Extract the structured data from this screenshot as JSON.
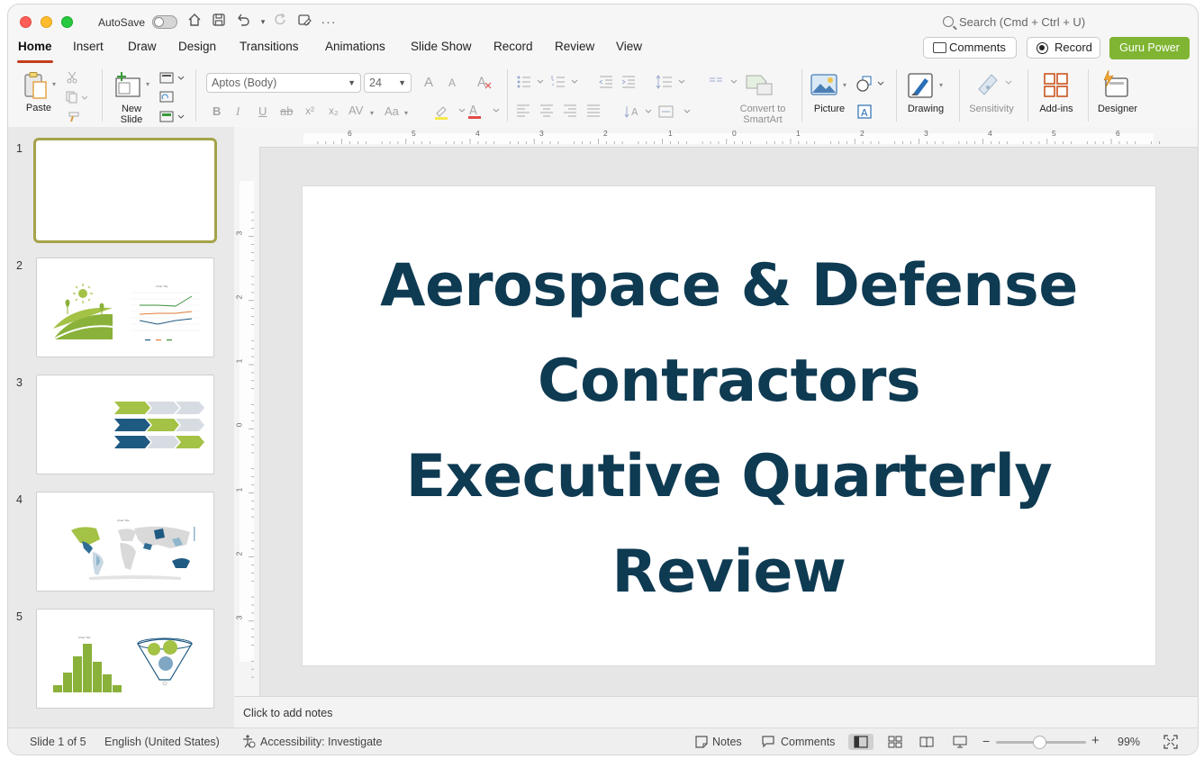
{
  "titlebar": {
    "autosave_label": "AutoSave",
    "search_placeholder": "Search (Cmd + Ctrl + U)"
  },
  "menu": {
    "tabs": [
      "Home",
      "Insert",
      "Draw",
      "Design",
      "Transitions",
      "Animations",
      "Slide Show",
      "Record",
      "Review",
      "View"
    ],
    "active_tab": "Home",
    "comments_label": "Comments",
    "record_label": "Record",
    "guru_label": "Guru Power"
  },
  "ribbon": {
    "paste": "Paste",
    "new_slide_line1": "New",
    "new_slide_line2": "Slide",
    "font_name": "Aptos (Body)",
    "font_size": "24",
    "convert_line1": "Convert to",
    "convert_line2": "SmartArt",
    "picture": "Picture",
    "drawing": "Drawing",
    "sensitivity": "Sensitivity",
    "addins": "Add-ins",
    "designer": "Designer",
    "bold": "B",
    "italic": "I",
    "underline": "U",
    "strike": "ab",
    "superscript": "x²",
    "subscript": "x₂",
    "spacing": "AV",
    "case": "Aa",
    "grow": "A",
    "shrink": "A"
  },
  "slides": {
    "numbers": [
      "1",
      "2",
      "3",
      "4",
      "5"
    ],
    "thumb2_chart_title": "Chart Title",
    "thumb4_chart_title": "Chart Title",
    "thumb5_chart_title": "Chart Title",
    "selected_index": 1
  },
  "ruler": {
    "h_labels": [
      "6",
      "5",
      "4",
      "3",
      "2",
      "1",
      "0",
      "1",
      "2",
      "3",
      "4",
      "5",
      "6"
    ],
    "v_labels": [
      "3",
      "2",
      "1",
      "0",
      "1",
      "2",
      "3"
    ]
  },
  "slide": {
    "title_lines": [
      "Aerospace & Defense",
      "Contractors",
      "Executive Quarterly",
      "Review"
    ]
  },
  "notes": {
    "placeholder": "Click to add notes"
  },
  "status": {
    "slide_position": "Slide 1 of 5",
    "language": "English (United States)",
    "accessibility": "Accessibility: Investigate",
    "notes": "Notes",
    "comments": "Comments",
    "zoom": "99%",
    "zoom_minus": "−",
    "zoom_plus": "+"
  },
  "colors": {
    "title_color": "#0e3a52",
    "accent_green": "#7fb532",
    "active_tab_underline": "#c43e1c",
    "selected_thumb_border": "#a4a34a"
  }
}
